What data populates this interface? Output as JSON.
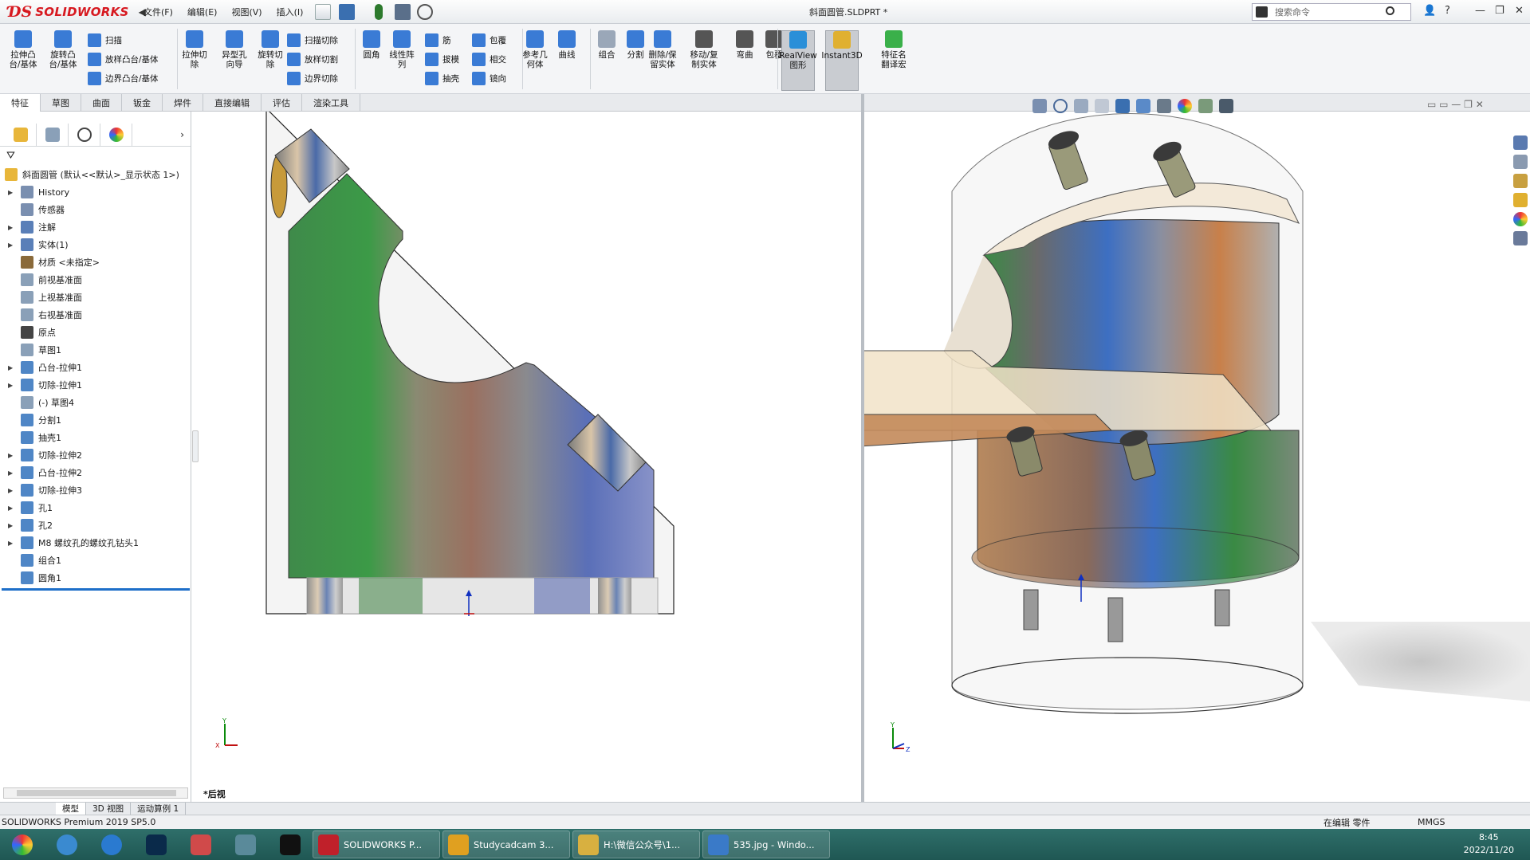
{
  "app": {
    "brand": "SOLIDWORKS",
    "doc_title": "斜面圆管.SLDPRT *"
  },
  "menu": [
    "文件(F)",
    "编辑(E)",
    "视图(V)",
    "插入(I)"
  ],
  "search": {
    "placeholder": "搜索命令"
  },
  "ribbon": {
    "big": [
      {
        "label": "拉伸凸\n台/基体",
        "color": "#3a7bd5"
      },
      {
        "label": "旋转凸\n台/基体",
        "color": "#3a7bd5"
      },
      {
        "label": "拉伸切\n除",
        "color": "#3a7bd5"
      },
      {
        "label": "异型孔\n向导",
        "color": "#3a7bd5"
      },
      {
        "label": "旋转切\n除",
        "color": "#3a7bd5"
      },
      {
        "label": "圆角",
        "color": "#3a7bd5"
      },
      {
        "label": "线性阵\n列",
        "color": "#3a7bd5"
      },
      {
        "label": "参考几\n何体",
        "color": "#3a7bd5"
      },
      {
        "label": "曲线",
        "color": "#3a7bd5"
      },
      {
        "label": "组合",
        "color": "#9aa7b8"
      },
      {
        "label": "分割",
        "color": "#3a7bd5"
      },
      {
        "label": "删除/保\n留实体",
        "color": "#3a7bd5"
      },
      {
        "label": "移动/复\n制实体",
        "color": "#555"
      },
      {
        "label": "弯曲",
        "color": "#555"
      },
      {
        "label": "包覆",
        "color": "#555"
      },
      {
        "label": "RealView\n图形",
        "color": "#2a8fd8"
      },
      {
        "label": "Instant3D",
        "color": "#e0b030"
      },
      {
        "label": "特征名\n翻译宏",
        "color": "#3ab04a"
      }
    ],
    "small": [
      {
        "label": "扫描"
      },
      {
        "label": "放样凸台/基体"
      },
      {
        "label": "边界凸台/基体"
      },
      {
        "label": "扫描切除"
      },
      {
        "label": "放样切割"
      },
      {
        "label": "边界切除"
      },
      {
        "label": "筋"
      },
      {
        "label": "拔模"
      },
      {
        "label": "抽壳"
      },
      {
        "label": "包覆"
      },
      {
        "label": "相交"
      },
      {
        "label": "镜向"
      }
    ]
  },
  "tabs": [
    "特征",
    "草图",
    "曲面",
    "钣金",
    "焊件",
    "直接编辑",
    "评估",
    "渲染工具"
  ],
  "tree": [
    {
      "label": "斜面圆管  (默认<<默认>_显示状态 1>)",
      "exp": false,
      "root": true,
      "color": "#e8b63a"
    },
    {
      "label": "History",
      "exp": true,
      "color": "#7a8fb0"
    },
    {
      "label": "传感器",
      "exp": false,
      "color": "#7a8fb0"
    },
    {
      "label": "注解",
      "exp": true,
      "color": "#5a7fb8"
    },
    {
      "label": "实体(1)",
      "exp": true,
      "color": "#5a7fb8"
    },
    {
      "label": "材质 <未指定>",
      "exp": false,
      "color": "#8a6a3a"
    },
    {
      "label": "前视基准面",
      "exp": false,
      "color": "#8aa0b8"
    },
    {
      "label": "上视基准面",
      "exp": false,
      "color": "#8aa0b8"
    },
    {
      "label": "右视基准面",
      "exp": false,
      "color": "#8aa0b8"
    },
    {
      "label": "原点",
      "exp": false,
      "color": "#444"
    },
    {
      "label": "草图1",
      "exp": false,
      "color": "#8aa0b8"
    },
    {
      "label": "凸台-拉伸1",
      "exp": true,
      "color": "#4f86c6"
    },
    {
      "label": "切除-拉伸1",
      "exp": true,
      "color": "#4f86c6"
    },
    {
      "label": "(-) 草图4",
      "exp": false,
      "color": "#8aa0b8"
    },
    {
      "label": "分割1",
      "exp": false,
      "color": "#4f86c6"
    },
    {
      "label": "抽壳1",
      "exp": false,
      "color": "#4f86c6"
    },
    {
      "label": "切除-拉伸2",
      "exp": true,
      "color": "#4f86c6"
    },
    {
      "label": "凸台-拉伸2",
      "exp": true,
      "color": "#4f86c6"
    },
    {
      "label": "切除-拉伸3",
      "exp": true,
      "color": "#4f86c6"
    },
    {
      "label": "孔1",
      "exp": true,
      "color": "#4f86c6"
    },
    {
      "label": "孔2",
      "exp": true,
      "color": "#4f86c6"
    },
    {
      "label": "M8 螺纹孔的螺纹孔钻头1",
      "exp": true,
      "color": "#4f86c6"
    },
    {
      "label": "组合1",
      "exp": false,
      "color": "#4f86c6"
    },
    {
      "label": "圆角1",
      "exp": false,
      "color": "#4f86c6"
    }
  ],
  "view_label": "*后视",
  "bottom_tabs": [
    "模型",
    "3D 视图",
    "运动算例 1"
  ],
  "status": {
    "version": "SOLIDWORKS Premium 2019 SP5.0",
    "mode": "在编辑 零件",
    "units": "MMGS"
  },
  "taskbar": {
    "tasks": [
      "SOLIDWORKS P...",
      "Studycadcam 3...",
      "H:\\微信公众号\\1...",
      "535.jpg - Windo..."
    ],
    "time": "8:45",
    "date": "2022/11/20"
  },
  "colors": {
    "accent": "#1e6fc9",
    "brand": "#d71920"
  }
}
